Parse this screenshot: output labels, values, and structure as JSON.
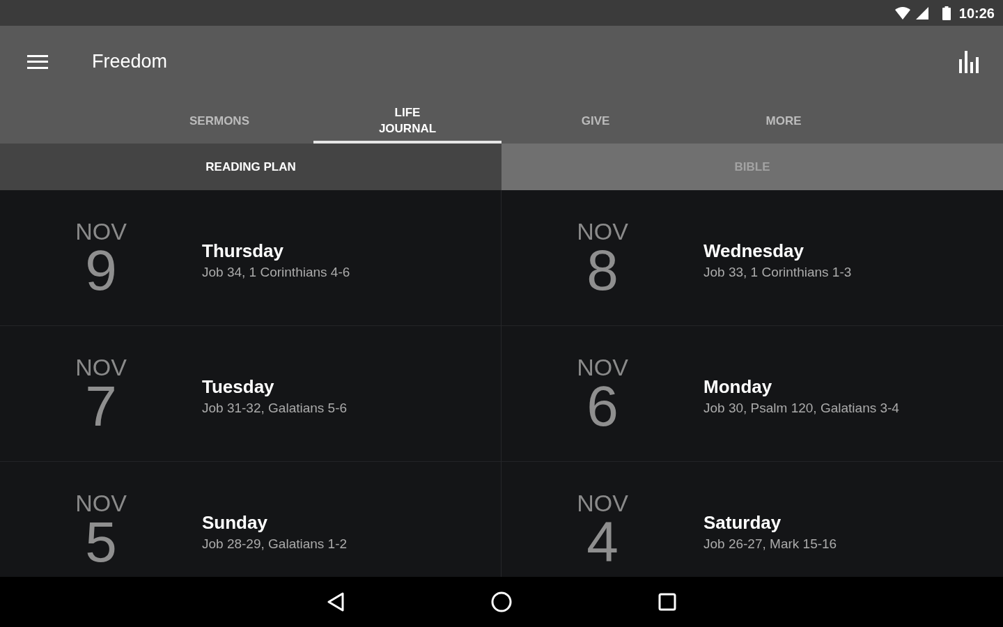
{
  "status_bar": {
    "time": "10:26"
  },
  "toolbar": {
    "title": "Freedom"
  },
  "tabs": [
    {
      "label": "SERMONS",
      "selected": false
    },
    {
      "label": "LIFE JOURNAL",
      "selected": true
    },
    {
      "label": "GIVE",
      "selected": false
    },
    {
      "label": "MORE",
      "selected": false
    }
  ],
  "subtabs": [
    {
      "label": "READING PLAN",
      "selected": true
    },
    {
      "label": "BIBLE",
      "selected": false
    }
  ],
  "entries": [
    {
      "month": "NOV",
      "day": "9",
      "weekday": "Thursday",
      "reading": "Job 34, 1 Corinthians 4-6"
    },
    {
      "month": "NOV",
      "day": "8",
      "weekday": "Wednesday",
      "reading": "Job 33, 1 Corinthians 1-3"
    },
    {
      "month": "NOV",
      "day": "7",
      "weekday": "Tuesday",
      "reading": "Job 31-32, Galatians 5-6"
    },
    {
      "month": "NOV",
      "day": "6",
      "weekday": "Monday",
      "reading": "Job 30, Psalm 120, Galatians 3-4"
    },
    {
      "month": "NOV",
      "day": "5",
      "weekday": "Sunday",
      "reading": "Job 28-29, Galatians 1-2"
    },
    {
      "month": "NOV",
      "day": "4",
      "weekday": "Saturday",
      "reading": "Job 26-27, Mark 15-16"
    }
  ]
}
